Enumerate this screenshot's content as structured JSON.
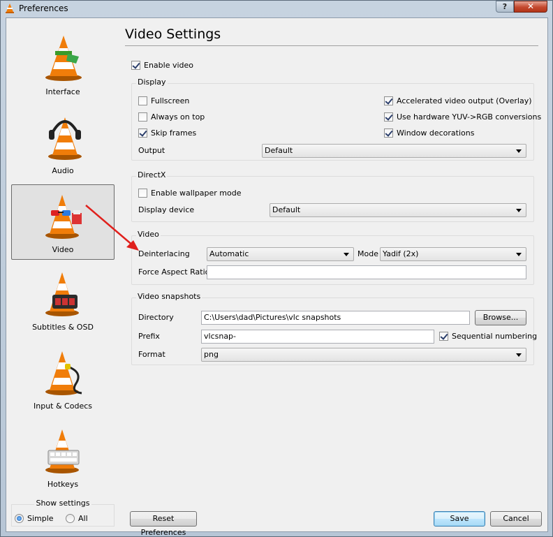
{
  "window": {
    "title": "Preferences",
    "help_label": "?",
    "close_label": "✕"
  },
  "sidebar": {
    "items": [
      {
        "label": "Interface",
        "icon": "vlc-cone-interface-icon"
      },
      {
        "label": "Audio",
        "icon": "vlc-cone-headphones-icon"
      },
      {
        "label": "Video",
        "icon": "vlc-cone-glasses-icon",
        "selected": true
      },
      {
        "label": "Subtitles & OSD",
        "icon": "vlc-cone-subtitles-icon"
      },
      {
        "label": "Input & Codecs",
        "icon": "vlc-cone-cable-icon"
      },
      {
        "label": "Hotkeys",
        "icon": "vlc-cone-keyboard-icon"
      }
    ],
    "show_settings": {
      "legend": "Show settings",
      "simple": "Simple",
      "all": "All",
      "selected": "simple"
    }
  },
  "main": {
    "title": "Video Settings",
    "enable_video": {
      "label": "Enable video",
      "checked": true
    },
    "display": {
      "title": "Display",
      "fullscreen": {
        "label": "Fullscreen",
        "checked": false
      },
      "always_on_top": {
        "label": "Always on top",
        "checked": false
      },
      "skip_frames": {
        "label": "Skip frames",
        "checked": true
      },
      "accelerated": {
        "label": "Accelerated video output (Overlay)",
        "checked": true
      },
      "hw_yuv": {
        "label": "Use hardware YUV->RGB conversions",
        "checked": true
      },
      "window_decorations": {
        "label": "Window decorations",
        "checked": true
      },
      "output_label": "Output",
      "output_value": "Default"
    },
    "directx": {
      "title": "DirectX",
      "wallpaper": {
        "label": "Enable wallpaper mode",
        "checked": false
      },
      "device_label": "Display device",
      "device_value": "Default"
    },
    "video": {
      "title": "Video",
      "deinterlacing_label": "Deinterlacing",
      "deinterlacing_value": "Automatic",
      "mode_label": "Mode",
      "mode_value": "Yadif (2x)",
      "aspect_label": "Force Aspect Ratio",
      "aspect_value": ""
    },
    "snapshots": {
      "title": "Video snapshots",
      "directory_label": "Directory",
      "directory_value": "C:\\Users\\dad\\Pictures\\vlc snapshots",
      "browse_label": "Browse...",
      "prefix_label": "Prefix",
      "prefix_value": "vlcsnap-",
      "sequential": {
        "label": "Sequential numbering",
        "checked": true
      },
      "format_label": "Format",
      "format_value": "png"
    }
  },
  "footer": {
    "reset_label": "Reset Preferences",
    "save_label": "Save",
    "cancel_label": "Cancel"
  },
  "colors": {
    "accent_arrow": "#e0201c",
    "cone_orange": "#f07d0a",
    "selection_bg": "#e1e1e1"
  }
}
